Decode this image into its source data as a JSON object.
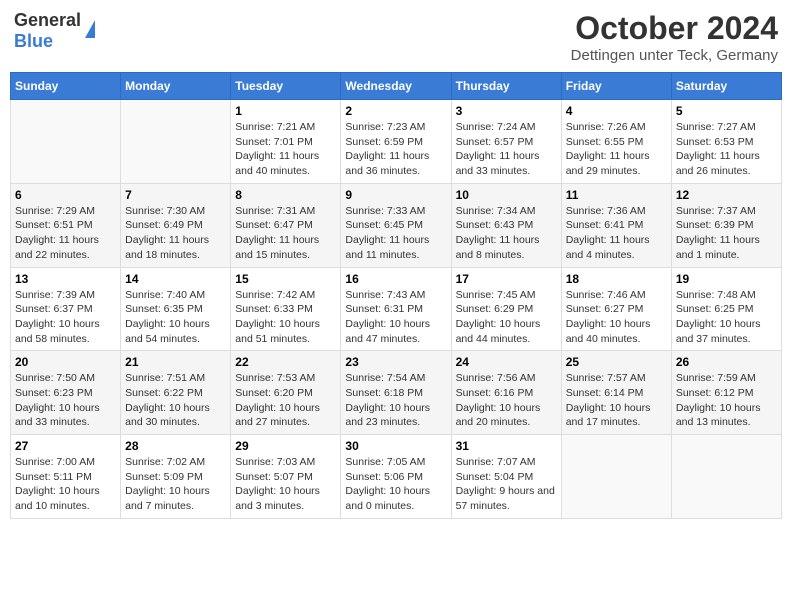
{
  "header": {
    "logo": {
      "general": "General",
      "blue": "Blue"
    },
    "title": "October 2024",
    "location": "Dettingen unter Teck, Germany"
  },
  "weekdays": [
    "Sunday",
    "Monday",
    "Tuesday",
    "Wednesday",
    "Thursday",
    "Friday",
    "Saturday"
  ],
  "weeks": [
    [
      {
        "day": "",
        "info": ""
      },
      {
        "day": "",
        "info": ""
      },
      {
        "day": "1",
        "info": "Sunrise: 7:21 AM\nSunset: 7:01 PM\nDaylight: 11 hours and 40 minutes."
      },
      {
        "day": "2",
        "info": "Sunrise: 7:23 AM\nSunset: 6:59 PM\nDaylight: 11 hours and 36 minutes."
      },
      {
        "day": "3",
        "info": "Sunrise: 7:24 AM\nSunset: 6:57 PM\nDaylight: 11 hours and 33 minutes."
      },
      {
        "day": "4",
        "info": "Sunrise: 7:26 AM\nSunset: 6:55 PM\nDaylight: 11 hours and 29 minutes."
      },
      {
        "day": "5",
        "info": "Sunrise: 7:27 AM\nSunset: 6:53 PM\nDaylight: 11 hours and 26 minutes."
      }
    ],
    [
      {
        "day": "6",
        "info": "Sunrise: 7:29 AM\nSunset: 6:51 PM\nDaylight: 11 hours and 22 minutes."
      },
      {
        "day": "7",
        "info": "Sunrise: 7:30 AM\nSunset: 6:49 PM\nDaylight: 11 hours and 18 minutes."
      },
      {
        "day": "8",
        "info": "Sunrise: 7:31 AM\nSunset: 6:47 PM\nDaylight: 11 hours and 15 minutes."
      },
      {
        "day": "9",
        "info": "Sunrise: 7:33 AM\nSunset: 6:45 PM\nDaylight: 11 hours and 11 minutes."
      },
      {
        "day": "10",
        "info": "Sunrise: 7:34 AM\nSunset: 6:43 PM\nDaylight: 11 hours and 8 minutes."
      },
      {
        "day": "11",
        "info": "Sunrise: 7:36 AM\nSunset: 6:41 PM\nDaylight: 11 hours and 4 minutes."
      },
      {
        "day": "12",
        "info": "Sunrise: 7:37 AM\nSunset: 6:39 PM\nDaylight: 11 hours and 1 minute."
      }
    ],
    [
      {
        "day": "13",
        "info": "Sunrise: 7:39 AM\nSunset: 6:37 PM\nDaylight: 10 hours and 58 minutes."
      },
      {
        "day": "14",
        "info": "Sunrise: 7:40 AM\nSunset: 6:35 PM\nDaylight: 10 hours and 54 minutes."
      },
      {
        "day": "15",
        "info": "Sunrise: 7:42 AM\nSunset: 6:33 PM\nDaylight: 10 hours and 51 minutes."
      },
      {
        "day": "16",
        "info": "Sunrise: 7:43 AM\nSunset: 6:31 PM\nDaylight: 10 hours and 47 minutes."
      },
      {
        "day": "17",
        "info": "Sunrise: 7:45 AM\nSunset: 6:29 PM\nDaylight: 10 hours and 44 minutes."
      },
      {
        "day": "18",
        "info": "Sunrise: 7:46 AM\nSunset: 6:27 PM\nDaylight: 10 hours and 40 minutes."
      },
      {
        "day": "19",
        "info": "Sunrise: 7:48 AM\nSunset: 6:25 PM\nDaylight: 10 hours and 37 minutes."
      }
    ],
    [
      {
        "day": "20",
        "info": "Sunrise: 7:50 AM\nSunset: 6:23 PM\nDaylight: 10 hours and 33 minutes."
      },
      {
        "day": "21",
        "info": "Sunrise: 7:51 AM\nSunset: 6:22 PM\nDaylight: 10 hours and 30 minutes."
      },
      {
        "day": "22",
        "info": "Sunrise: 7:53 AM\nSunset: 6:20 PM\nDaylight: 10 hours and 27 minutes."
      },
      {
        "day": "23",
        "info": "Sunrise: 7:54 AM\nSunset: 6:18 PM\nDaylight: 10 hours and 23 minutes."
      },
      {
        "day": "24",
        "info": "Sunrise: 7:56 AM\nSunset: 6:16 PM\nDaylight: 10 hours and 20 minutes."
      },
      {
        "day": "25",
        "info": "Sunrise: 7:57 AM\nSunset: 6:14 PM\nDaylight: 10 hours and 17 minutes."
      },
      {
        "day": "26",
        "info": "Sunrise: 7:59 AM\nSunset: 6:12 PM\nDaylight: 10 hours and 13 minutes."
      }
    ],
    [
      {
        "day": "27",
        "info": "Sunrise: 7:00 AM\nSunset: 5:11 PM\nDaylight: 10 hours and 10 minutes."
      },
      {
        "day": "28",
        "info": "Sunrise: 7:02 AM\nSunset: 5:09 PM\nDaylight: 10 hours and 7 minutes."
      },
      {
        "day": "29",
        "info": "Sunrise: 7:03 AM\nSunset: 5:07 PM\nDaylight: 10 hours and 3 minutes."
      },
      {
        "day": "30",
        "info": "Sunrise: 7:05 AM\nSunset: 5:06 PM\nDaylight: 10 hours and 0 minutes."
      },
      {
        "day": "31",
        "info": "Sunrise: 7:07 AM\nSunset: 5:04 PM\nDaylight: 9 hours and 57 minutes."
      },
      {
        "day": "",
        "info": ""
      },
      {
        "day": "",
        "info": ""
      }
    ]
  ]
}
